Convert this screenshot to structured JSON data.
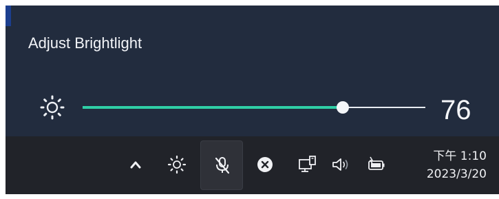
{
  "flyout": {
    "title": "Adjust Brightlight",
    "brightness_icon": "sun-icon",
    "brightness_value": "76",
    "brightness_level": 76
  },
  "taskbar": {
    "icons": [
      "chevron-up-icon",
      "brightness-icon",
      "microphone-muted-icon",
      "close-circle-icon",
      "network-icon",
      "volume-icon",
      "battery-charging-icon"
    ],
    "clock": {
      "time": "下午 1:10",
      "date": "2023/3/20"
    }
  },
  "colors": {
    "flyout_bg": "#222c3e",
    "taskbar_bg": "#212329",
    "accent": "#2fcfa6",
    "text": "#f2f4f8"
  }
}
